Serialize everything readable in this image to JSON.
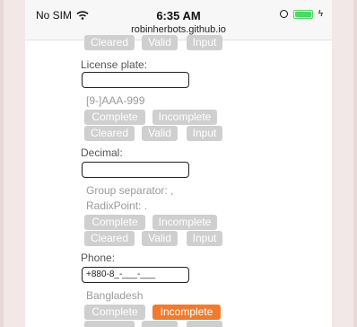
{
  "status": {
    "carrier": "No SIM",
    "time": "6:35 AM",
    "url": "robinherbots.github.io"
  },
  "form": {
    "top_buttons": [
      "Cleared",
      "Valid",
      "Input"
    ],
    "license": {
      "label": "License plate:",
      "value": "",
      "mask": "[9-]AAA-999",
      "buttons": [
        "Complete",
        "Incomplete",
        "Cleared",
        "Valid",
        "Input"
      ]
    },
    "decimal": {
      "label": "Decimal:",
      "value": "",
      "group_separator": "Group separator: ,",
      "radix_point": "RadixPoint: .",
      "buttons": [
        "Complete",
        "Incomplete",
        "Cleared",
        "Valid",
        "Input"
      ]
    },
    "phone": {
      "label": "Phone:",
      "value": "+880-8_-___-___",
      "country": "Bangladesh",
      "buttons": [
        "Complete",
        "Incomplete"
      ]
    }
  },
  "colors": {
    "active": "#f07b2e",
    "inactive": "#cfcfcf"
  }
}
